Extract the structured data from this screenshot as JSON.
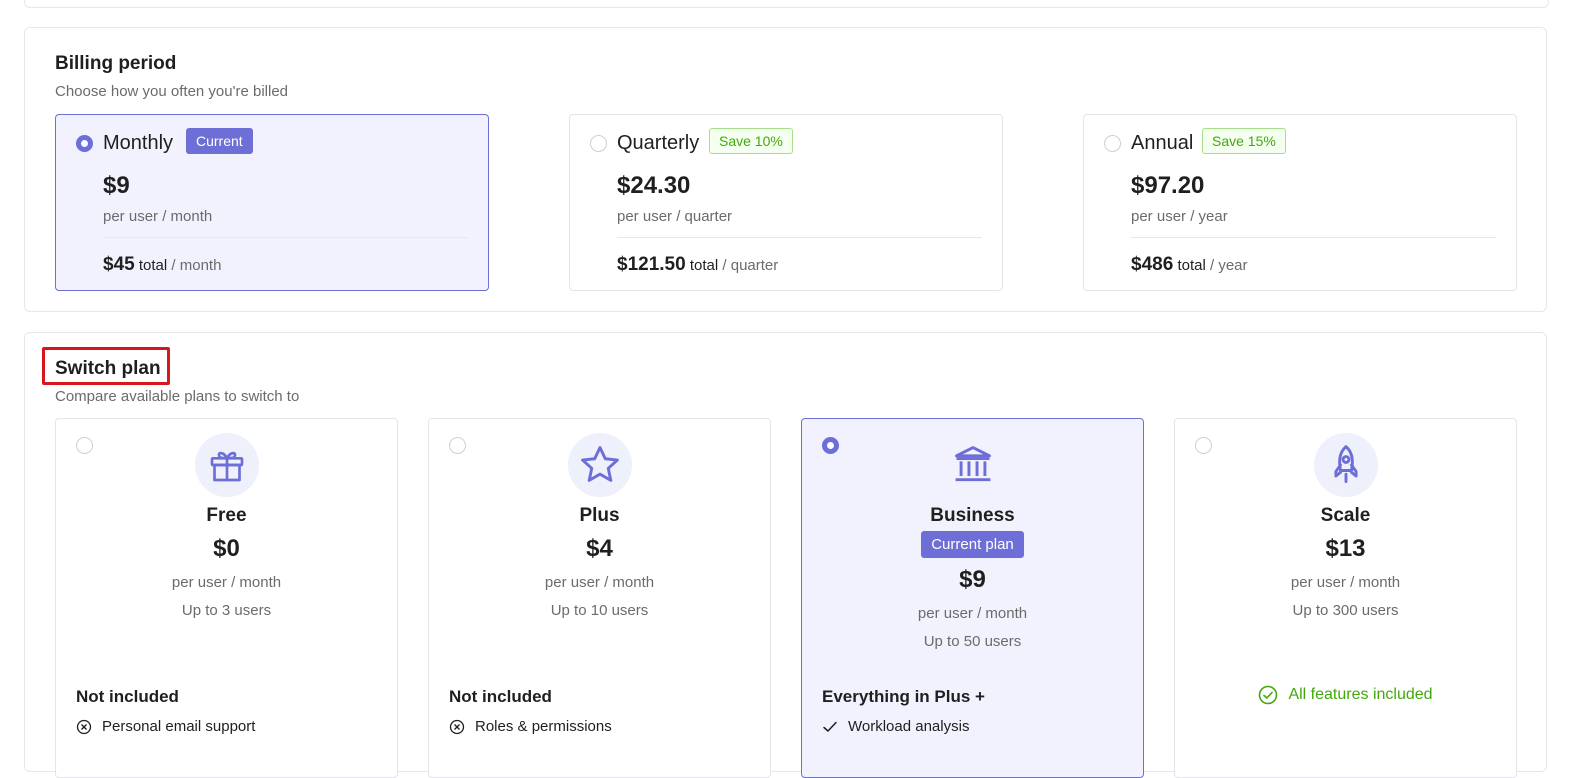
{
  "billing": {
    "title": "Billing period",
    "subtitle": "Choose how you often you're billed",
    "options": [
      {
        "name": "Monthly",
        "badge": "Current",
        "price": "$9",
        "unit": "per user / month",
        "total_amount": "$45",
        "total_word": "total",
        "total_period": "/ month",
        "selected": true
      },
      {
        "name": "Quarterly",
        "badge": "Save 10%",
        "price": "$24.30",
        "unit": "per user / quarter",
        "total_amount": "$121.50",
        "total_word": "total",
        "total_period": "/ quarter",
        "selected": false
      },
      {
        "name": "Annual",
        "badge": "Save 15%",
        "price": "$97.20",
        "unit": "per user / year",
        "total_amount": "$486",
        "total_word": "total",
        "total_period": "/ year",
        "selected": false
      }
    ]
  },
  "plans": {
    "title": "Switch plan",
    "subtitle": "Compare available plans to switch to",
    "items": [
      {
        "name": "Free",
        "price": "$0",
        "unit": "per user / month",
        "users": "Up to 3 users",
        "feature_heading": "Not included",
        "feature_first": "Personal email support",
        "icon": "gift-icon",
        "selected": false
      },
      {
        "name": "Plus",
        "price": "$4",
        "unit": "per user / month",
        "users": "Up to 10 users",
        "feature_heading": "Not included",
        "feature_first": "Roles & permissions",
        "icon": "star-icon",
        "selected": false
      },
      {
        "name": "Business",
        "badge": "Current plan",
        "price": "$9",
        "unit": "per user / month",
        "users": "Up to 50 users",
        "feature_heading": "Everything in Plus +",
        "feature_first": "Workload analysis",
        "icon": "bank-icon",
        "selected": true
      },
      {
        "name": "Scale",
        "price": "$13",
        "unit": "per user / month",
        "users": "Up to 300 users",
        "all_features": "All features included",
        "icon": "rocket-icon",
        "selected": false
      }
    ]
  },
  "colors": {
    "accent": "#6d6fd6",
    "selected_bg": "#f1f2fd",
    "save_green": "#43a80e",
    "highlight_red": "#d6171f"
  }
}
